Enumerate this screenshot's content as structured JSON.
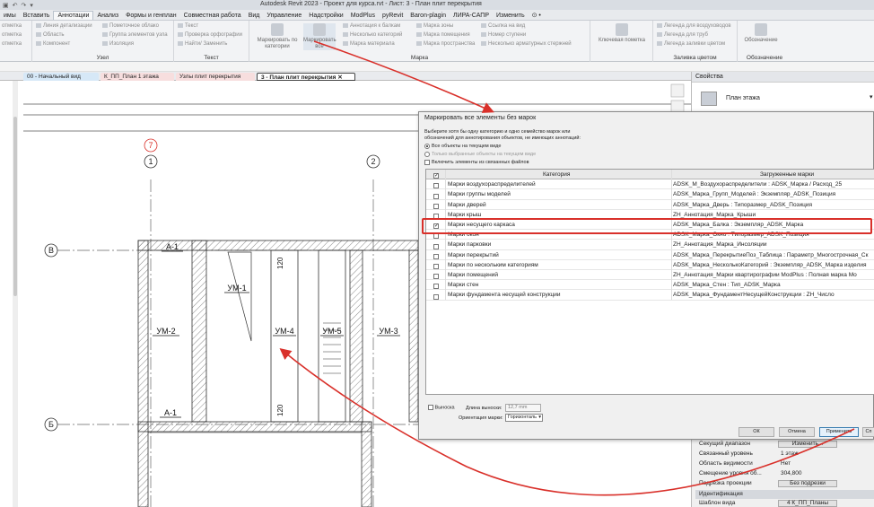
{
  "titlebar": {
    "qat": [
      "▣",
      "↶",
      "↷",
      "▾"
    ],
    "title": "Autodesk Revit 2023 - Проект для курса.rvt - Лист: 3 - План плит перекрытия"
  },
  "menu": [
    "имы",
    "Вставить",
    "Аннотации",
    "Анализ",
    "Формы и генплан",
    "Совместная работа",
    "Вид",
    "Управление",
    "Надстройки",
    "ModPlus",
    "pyRevit",
    "Baron-plagin",
    "ЛИРА-САПР",
    "Изменить",
    "⊙ •"
  ],
  "ribbon": {
    "left": {
      "rows": [
        "отметка",
        "отметка",
        "отметка"
      ]
    },
    "detail": {
      "rows": [
        "Линия детализации",
        "Область",
        "Компонент"
      ],
      "rows2": [
        "Пометочное облако",
        "Группа элементов узла",
        "Изоляция"
      ],
      "title": "Узел"
    },
    "text": {
      "rows": [
        "Текст",
        "Проверка орфографии",
        "Найти/ Заменить"
      ],
      "title": "Текст"
    },
    "tag": {
      "big1": "Маркировать по категории",
      "big2": "Маркировать все",
      "rows": [
        "Аннотация к балкам",
        "Несколько категорий",
        "Марка материала"
      ],
      "rows2": [
        "Марка зоны",
        "Марка помещения",
        "Марка пространства"
      ],
      "rows3": [
        "Ссылка на вид",
        "Номер ступени",
        "Несколько арматурных стержней"
      ],
      "title": "Марка"
    },
    "key": {
      "big": "Ключевая пометка"
    },
    "legend": {
      "rows": [
        "Легенда для воздуховодов",
        "Легенда для труб",
        "Легенда заливки цветом"
      ],
      "title": "Заливка цветом"
    },
    "symbol": {
      "big": "Обозначение",
      "title": "Обозначение"
    }
  },
  "tabs": [
    {
      "label": "00 - Начальный вид",
      "color": "#d6e8f7"
    },
    {
      "label": "К_ПП_План 1 этажа",
      "color": "#f7dede"
    },
    {
      "label": "Узлы плит перекрытия",
      "color": "#f7dede"
    },
    {
      "label": "3 - План плит перекрытия",
      "color": "#ffffff"
    }
  ],
  "plan": {
    "grid": [
      "7",
      "1",
      "2"
    ],
    "rows": [
      "В",
      "Б"
    ],
    "labels": [
      "А-1",
      "А-1",
      "УМ-1",
      "УМ-2",
      "УМ-4",
      "УМ-5",
      "УМ-3",
      "120",
      "120"
    ]
  },
  "properties": {
    "title": "Свойства",
    "type": "План этажа",
    "rows": [
      {
        "k": "Секущий диапазон",
        "v": "Изменить...",
        "btn": true
      },
      {
        "k": "Связанный уровень",
        "v": "1 этаж"
      },
      {
        "k": "Область видимости",
        "v": "Нет"
      },
      {
        "k": "Смещение уровня об...",
        "v": "304,800"
      },
      {
        "k": "Подрезка проекции",
        "v": "Без подрезки",
        "btn": true
      }
    ],
    "section": "Идентификация",
    "last": {
      "k": "Шаблон вида",
      "v": "4 К_ПП_Планы",
      "btn": true
    }
  },
  "dialog": {
    "title": "Маркировать все элементы без марок",
    "instructions": "Выберите хотя бы одну категорию и одно семейство марок или обозначений для аннотирования объектов, не имеющих аннотаций:",
    "radio_all": "Все объекты на текущем виде",
    "radio_selected": "Только выбранные объекты на текущем виде",
    "include_linked": "Включить элементы из связанных файлов",
    "col_category": "Категория",
    "col_tags": "Загруженные марки",
    "rows": [
      {
        "cat": "Марки воздухораспределителей",
        "tag": "ADSK_M_Воздухораспределители : ADSK_Марка / Расход_25",
        "checked": false
      },
      {
        "cat": "Марки группы моделей",
        "tag": "ADSK_Марка_Групп_Моделей : Экземпляр_ADSK_Позиция",
        "checked": false
      },
      {
        "cat": "Марки дверей",
        "tag": "ADSK_Марка_Дверь : Типоразмер_ADSK_Позиция",
        "checked": false
      },
      {
        "cat": "Марки крыш",
        "tag": "ZH_Аннотация_Марка_Крыши",
        "checked": false
      },
      {
        "cat": "Марки несущего каркаса",
        "tag": "ADSK_Марка_Балка : Экземпляр_ADSK_Марка",
        "checked": true
      },
      {
        "cat": "Марки окон",
        "tag": "ADSK_Марка_Окно : Типоразмер_ADSK_Позиция",
        "checked": false
      },
      {
        "cat": "Марки парковки",
        "tag": "ZH_Аннотация_Марка_Инсоляции",
        "checked": false
      },
      {
        "cat": "Марки перекрытий",
        "tag": "ADSK_Марка_ПерекрытиеПоз_Таблица : Параметр_Многострочная_Ск",
        "checked": false
      },
      {
        "cat": "Марки по нескольким категориям",
        "tag": "ADSK_Марка_НесколькоКатегорий : Экземпляр_ADSK_Марка изделия",
        "checked": false
      },
      {
        "cat": "Марки помещений",
        "tag": "ZH_Аннотация_Марки квартирографии ModPlus : Полная марка Mo",
        "checked": false
      },
      {
        "cat": "Марки стен",
        "tag": "ADSK_Марка_Стен : Тип_ADSK_Марка",
        "checked": false
      },
      {
        "cat": "Марки фундамента несущей конструкции",
        "tag": "ADSK_Марка_ФундаментНесущейКонструкции : ZH_Число",
        "checked": false
      }
    ],
    "leader_label": "Выноска",
    "leader_length_label": "Длина выноски:",
    "leader_length_value": "12,7 mm",
    "orientation_label": "Ориентация марки:",
    "orientation_value": "Горизонталь",
    "buttons": {
      "ok": "ОК",
      "cancel": "Отмена",
      "apply": "Применить",
      "help": "Сп"
    }
  }
}
